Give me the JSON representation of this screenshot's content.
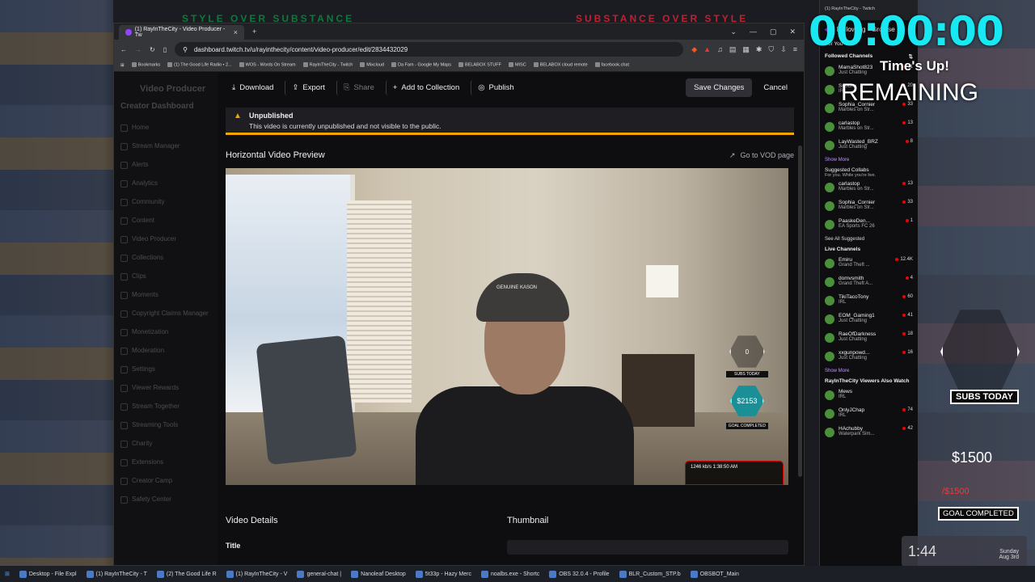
{
  "overlay": {
    "top_banner_left": "STYLE OVER SUBSTANCE",
    "top_banner_right": "SUBSTANCE OVER STYLE",
    "timer": "00:00:00",
    "times_up": "Time's Up!",
    "remaining": "REMAINING",
    "subs_today": "SUBS TODAY",
    "goal_amount": "$1500",
    "goal_target": "/$1500",
    "goal_completed": "GOAL COMPLETED",
    "clock_time": "1:44",
    "clock_day": "Sunday",
    "clock_date": "Aug 3rd"
  },
  "browser": {
    "tab_title": "(1) RayInTheCity - Video Producer - Tw",
    "url": "dashboard.twitch.tv/u/rayinthecity/content/video-producer/edit/2834432029",
    "bookmarks": [
      "Bookmarks",
      "(1) The Good Life Radio • 2...",
      "WOS - Words On Stream",
      "RayInTheCity - Twitch",
      "Mixcloud",
      "Da Fam - Google My Maps",
      "BELABOX STUFF",
      "MISC",
      "BELABOX cloud remote",
      "facebook.chat"
    ]
  },
  "sidebar": {
    "title": "Video Producer",
    "dashboard": "Creator Dashboard",
    "items": [
      "Home",
      "Stream Manager",
      "Alerts",
      "Analytics",
      "Community",
      "Content",
      "Video Producer",
      "Collections",
      "Clips",
      "Moments",
      "Copyright Claims Manager",
      "Monetization",
      "Moderation",
      "Settings",
      "Viewer Rewards",
      "Stream Together",
      "Streaming Tools",
      "Charity",
      "Extensions",
      "Creator Camp",
      "Safety Center"
    ]
  },
  "toolbar": {
    "download": "Download",
    "export": "Export",
    "share": "Share",
    "add_collection": "Add to Collection",
    "publish": "Publish",
    "save": "Save Changes",
    "cancel": "Cancel"
  },
  "alert": {
    "title": "Unpublished",
    "text": "This video is currently unpublished and not visible to the public."
  },
  "preview": {
    "heading": "Horizontal Video Preview",
    "vod_link": "Go to VOD page",
    "cap_text": "GENUINE KASON",
    "hex_count": "0",
    "subs_today": "SUBS TODAY",
    "goal_amount": "$2153",
    "goal_completed": "GOAL COMPLETED",
    "live_stats": "1246 kb/s   1:38:50 AM"
  },
  "details": {
    "heading": "Video Details",
    "thumbnail": "Thumbnail",
    "title_label": "Title"
  },
  "twitch": {
    "tab": "(1) RayInTheCity - Twitch",
    "nav_following": "Following",
    "nav_browse": "Browse",
    "for_you": "For You",
    "followed_channels": "Followed Channels",
    "followed": [
      {
        "name": "MamaShot823",
        "game": "Just Chatting",
        "count": "11"
      },
      {
        "name": "Soochu",
        "game": "IRL",
        "count": "20"
      },
      {
        "name": "Sophia_Cornier",
        "game": "Marbles on Str...",
        "count": "33"
      },
      {
        "name": "carlastop",
        "game": "Marbles on Str...",
        "count": "13"
      },
      {
        "name": "LayWasted_BRZ",
        "game": "Just Chatting",
        "count": "8"
      }
    ],
    "show_more": "Show More",
    "suggested_collabs": "Suggested Collabs",
    "for_you_sub": "For you. While you're live.",
    "suggested": [
      {
        "name": "carlastop",
        "game": "Marbles on Str...",
        "count": "13"
      },
      {
        "name": "Sophia_Cornier",
        "game": "Marbles on Str...",
        "count": "33"
      },
      {
        "name": "PaaskeDen...",
        "game": "EA Sports FC 26",
        "count": "1"
      }
    ],
    "see_all": "See All Suggested",
    "live_channels": "Live Channels",
    "live": [
      {
        "name": "Emiru",
        "game": "Grand Theft ...",
        "count": "12.4K"
      },
      {
        "name": "domvsmith",
        "game": "Grand Theft A...",
        "count": "4"
      },
      {
        "name": "TikiTacoTony",
        "game": "IRL",
        "count": "60"
      },
      {
        "name": "EOM_Gaming1",
        "game": "Just Chatting",
        "count": "41"
      },
      {
        "name": "RaeOfDarkness",
        "game": "Just Chatting",
        "count": "18"
      },
      {
        "name": "xxgunpowd...",
        "game": "Just Chatting",
        "count": "16"
      }
    ],
    "viewers_watch": "RayInTheCity Viewers Also Watch",
    "also": [
      {
        "name": "Mews",
        "game": "IRL",
        "count": ""
      },
      {
        "name": "OnlyJChap",
        "game": "IRL",
        "count": "74"
      },
      {
        "name": "HAchubby",
        "game": "Waterpark Sim...",
        "count": "42"
      }
    ]
  },
  "taskbar": [
    "Desktop - File Expl",
    "(1) RayInTheCity - T",
    "(2) The Good Life R",
    "(1) RayInTheCity - V",
    "general-chat |",
    "Nanoleaf Desktop",
    "5t33p - Hazy Merc",
    "noalbs.exe - Shortc",
    "OBS 32.0.4 - Profile",
    "BLR_Custom_STP.b",
    "OBSBOT_Main"
  ]
}
